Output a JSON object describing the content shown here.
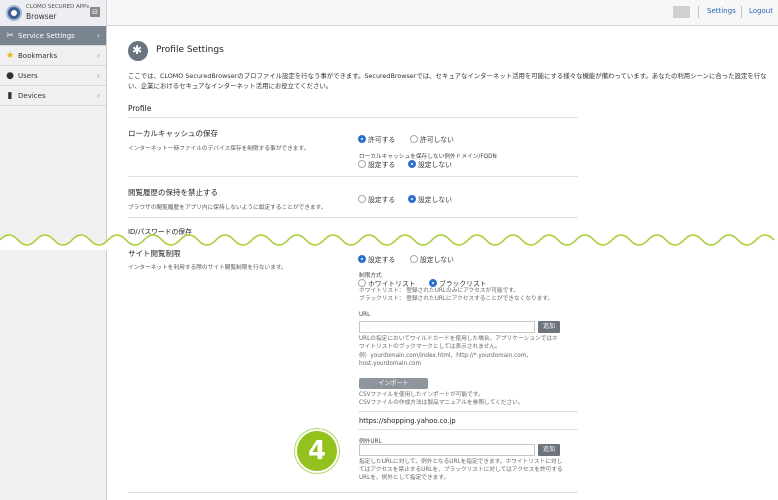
{
  "app": {
    "brand_line1": "CLOMO SECURED APPs",
    "brand_line2": "Browser"
  },
  "topbar": {
    "settings_link": "Settings",
    "logout_link": "Logout"
  },
  "sidebar": {
    "items": [
      {
        "label": "Service Settings",
        "icon": "wrench-icon",
        "active": true
      },
      {
        "label": "Bookmarks",
        "icon": "star-icon",
        "active": false
      },
      {
        "label": "Users",
        "icon": "user-icon",
        "active": false
      },
      {
        "label": "Devices",
        "icon": "device-icon",
        "active": false
      }
    ]
  },
  "page": {
    "title": "Profile Settings",
    "intro": "ここでは、CLOMO SecuredBrowserのプロファイル設定を行なう事ができます。SecuredBrowserでは、セキュアなインターネット活用を可能にする様々な機能が備わっています。あなたの利用シーンに合った設定を行ない、企業におけるセキュアなインターネット活用にお役立てください。",
    "section_title": "Profile"
  },
  "local_cache": {
    "title": "ローカルキャッシュの保存",
    "desc": "インターネット一時ファイルのデバイス保存を制限する事ができます。",
    "opt_allow": "許可する",
    "opt_deny": "許可しない",
    "selected": "allow",
    "exception_label": "ローカルキャッシュを保存しない例外ドメイン/FQDN",
    "exc_set": "設定する",
    "exc_unset": "設定しない",
    "exc_selected": "unset"
  },
  "history": {
    "title": "閲覧履歴の保持を禁止する",
    "desc": "ブラウザの閲覧履歴をアプリ内に保持しないように設定することができます。",
    "opt_set": "設定する",
    "opt_unset": "設定しない",
    "selected": "unset"
  },
  "id_password": {
    "title": "ID/パスワードの保存"
  },
  "site_restriction": {
    "title": "サイト閲覧制限",
    "desc": "インターネットを利用する際のサイト閲覧制限を行ないます。",
    "opt_set": "設定する",
    "opt_unset": "設定しない",
    "selected": "set",
    "method_label": "制限方式",
    "whitelist": "ホワイトリスト",
    "blacklist": "ブラックリスト",
    "method_selected": "blacklist",
    "whitelist_note": "ホワイトリスト： 登録されたURLのみにアクセスが可能です。",
    "blacklist_note": "ブラックリスト： 登録されたURLにアクセスすることができなくなります。",
    "url_label": "URL",
    "url_value": "",
    "add_button": "追加",
    "url_note_1": "URLの指定においてワイルドカードを使用した場合、アプリケーションではホ",
    "url_note_2": "ワイトリストのブックマークとしては表示されません。",
    "url_note_3": "例）yourdomain.com/index.html、http://*.yourdomain.com、",
    "url_note_4": "host.yourdomain.com",
    "import_button": "インポート",
    "import_note_1": "CSVファイルを使用したインポートが可能です。",
    "import_note_2": "CSVファイルの作成方法は製品マニュアルを参照してください。",
    "registered_url": "https://shopping.yahoo.co.jp",
    "exception_url_label": "例外URL",
    "exception_url_value": "",
    "exception_add_button": "追加",
    "exception_note_1": "指定したURLに対して、例外となるURLを指定できます。ホワイトリストに対し",
    "exception_note_2": "てはアクセスを禁止するURLを、ブラックリストに対してはアクセスを許可する",
    "exception_note_3": "URLを、例外として指定できます。"
  },
  "annotation": {
    "step_number": "4",
    "color": "#93c11d"
  },
  "colors": {
    "accent": "#2f6fce",
    "sidebar_active": "#7a8390",
    "wave": "#a6cc2e"
  }
}
